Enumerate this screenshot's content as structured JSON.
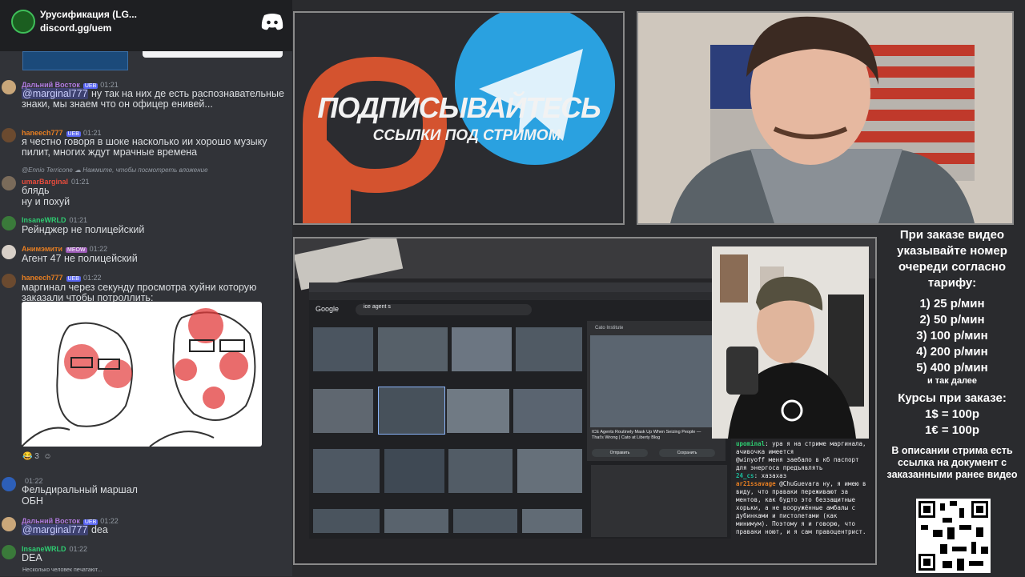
{
  "discord": {
    "server_name": "Урусификация (LG...",
    "invite": "discord.gg/uem",
    "typing": "Несколько человек печатают...",
    "messages": [
      {
        "user": "Дальний Восток",
        "badge": "UEB",
        "time": "01:21",
        "text_mention": "@marginal777",
        "text": " ну так на них де есть распознавательные знаки, мы знаем что он офицер енивей..."
      },
      {
        "user": "haneech777",
        "badge": "UEB",
        "time": "01:21",
        "text": "я честно говоря в шоке насколько ии хорошо музыку пилит, многих ждут мрачные времена"
      },
      {
        "reply": "@Ennio Terricone ☁ Нажмите, чтобы посмотреть вложение",
        "user": "umarBarginal",
        "time": "01:21",
        "line1": "блядь",
        "line2": "ну и похуй"
      },
      {
        "user": "InsaneWRLD",
        "time": "01:21",
        "text": "Рейнджер не полицейский"
      },
      {
        "user": "Анимэмити",
        "badge": "MEOW",
        "time": "01:22",
        "text": "Агент 47 не полицейский"
      },
      {
        "user": "haneech777",
        "badge": "UEB",
        "time": "01:22",
        "text": "маргинал через секунду просмотра хуйни которую заказали чтобы потроллить:"
      },
      {
        "user": "",
        "time": "01:22",
        "line1": "Фельдиральный маршал",
        "line2": "ОБН"
      },
      {
        "user": "Дальний Восток",
        "badge": "UEB",
        "time": "01:22",
        "text_mention": "@marginal777",
        "text": " dea"
      },
      {
        "user": "InsaneWRLD",
        "time": "01:22",
        "text": "DEA"
      }
    ],
    "reaction_count": "3"
  },
  "promo": {
    "title": "ПОДПИСЫВАЙТЕСЬ",
    "subtitle": "ССЫЛКИ ПОД СТРИМОМ"
  },
  "browser": {
    "search_query": "ice agent s",
    "logo": "Google",
    "panel_source": "Cato Institute",
    "panel_caption": "ICE Agents Routinely Mask Up When Seizing People —That's Wrong | Cato at Liberty Blog",
    "btn_send": "Отправить",
    "btn_save": "Сохранить"
  },
  "twitch_chat": [
    {
      "user": "upominal",
      "text": "ура я на стриме маргинала, ачивочка имеется"
    },
    {
      "user": "",
      "text": "@winyoff меня заебало в кб паспорт для энергоса предъявлять"
    },
    {
      "user": "24_cs",
      "text": "хазахаз"
    },
    {
      "user": "ar21ssavage",
      "text": "@ChuGuevara ну, я имею в виду, что правaки переживают за ментов, как будто это беззащитные хорьки, а не вооружённые амбалы с дубинками и пистолетами (как минимум). Поэтому я и говорю, что правaки ноют, и я сам правоцентрист."
    }
  ],
  "info": {
    "intro": "При заказе видео указывайте номер очереди согласно тарифу:",
    "prices": [
      "1) 25 р/мин",
      "2) 50 р/мин",
      "3) 100 р/мин",
      "4) 200 р/мин",
      "5) 400 р/мин"
    ],
    "etc": "и так далее",
    "courses_title": "Курсы при заказе:",
    "courses": [
      "1$ = 100р",
      "1€ = 100р"
    ],
    "note": "В описании стрима есть ссылка на документ с заказанными ранее видео"
  },
  "colors": {
    "discord_bg": "#313338",
    "accent": "#5865f2",
    "promo_orange": "#d4532f",
    "promo_blue": "#2aa1e0"
  }
}
